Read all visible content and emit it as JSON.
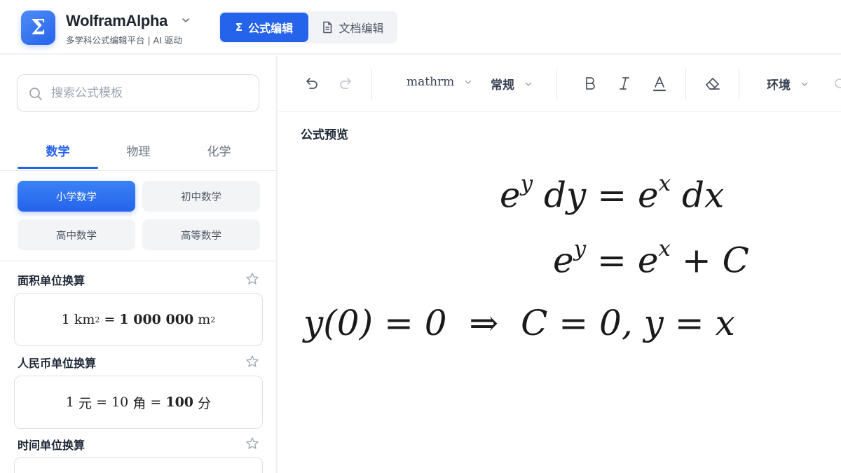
{
  "header": {
    "brand": "WolframAlpha",
    "logo_glyph": "Σ",
    "subtitle": "多学科公式编辑平台 | AI 驱动",
    "modes": [
      {
        "label": "公式编辑",
        "icon": "sigma-icon",
        "active": true
      },
      {
        "label": "文档编辑",
        "icon": "document-icon",
        "active": false
      }
    ],
    "accent_color": "#2563eb"
  },
  "sidebar": {
    "search_placeholder": "搜索公式模板",
    "tabs": [
      {
        "label": "数学",
        "active": true
      },
      {
        "label": "物理",
        "active": false
      },
      {
        "label": "化学",
        "active": false
      }
    ],
    "categories": [
      {
        "label": "小学数学",
        "active": true
      },
      {
        "label": "初中数学",
        "active": false
      },
      {
        "label": "高中数学",
        "active": false
      },
      {
        "label": "高等数学",
        "active": false
      }
    ],
    "templates": [
      {
        "title": "面积单位换算",
        "formula": {
          "a": "1",
          "a_unit": "km",
          "a_exp": "2",
          "eq": "=",
          "b": "1 000 000",
          "b_unit": "m",
          "b_exp": "2"
        }
      },
      {
        "title": "人民币单位换算",
        "formula": {
          "p1": "1",
          "u1": "元",
          "eq1": "=",
          "p2": "10",
          "u2": "角",
          "eq2": "=",
          "p3": "100",
          "u3": "分"
        }
      },
      {
        "title": "时间单位换算"
      }
    ]
  },
  "toolbar": {
    "font_select": "mathrm",
    "style_select": "常规",
    "env_select": "环境",
    "icons": [
      "undo-icon",
      "redo-icon",
      "bold-icon",
      "italic-icon",
      "font-color-icon",
      "eraser-icon"
    ]
  },
  "preview": {
    "label": "公式预览",
    "lines": [
      {
        "lhs_base": "e",
        "lhs_exp": "y",
        "lhs_d": "dy",
        "op": "=",
        "rhs_base": "e",
        "rhs_exp": "x",
        "rhs_d": "dx"
      },
      {
        "lhs_base": "e",
        "lhs_exp": "y",
        "op": "=",
        "rhs_base": "e",
        "rhs_exp": "x",
        "plus": "+",
        "const": "C"
      },
      {
        "cond": "y(0) = 0",
        "arrow": "⇒",
        "result": "C = 0,",
        "final": "y = x"
      }
    ]
  }
}
